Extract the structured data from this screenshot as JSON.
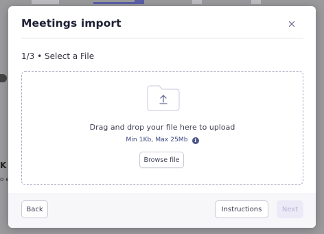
{
  "modal": {
    "title": "Meetings import",
    "step": "1/3 • Select a File"
  },
  "dropzone": {
    "instruction": "Drag and drop your file here to upload",
    "limits": "Min 1Kb, Max 25Mb",
    "browse_label": "Browse file"
  },
  "footer": {
    "back_label": "Back",
    "instructions_label": "Instructions",
    "next_label": "Next"
  },
  "background": {
    "text_a": "K",
    "text_b": "o e"
  },
  "icons": {
    "close": "close-icon",
    "upload": "upload-file-icon",
    "info": "info-icon"
  },
  "colors": {
    "title": "#1e1f33",
    "limits_text": "#3b4880",
    "next_disabled_bg": "#eceaf7",
    "next_disabled_text": "#b6b4d6",
    "overlay": "#9a9a9d"
  }
}
